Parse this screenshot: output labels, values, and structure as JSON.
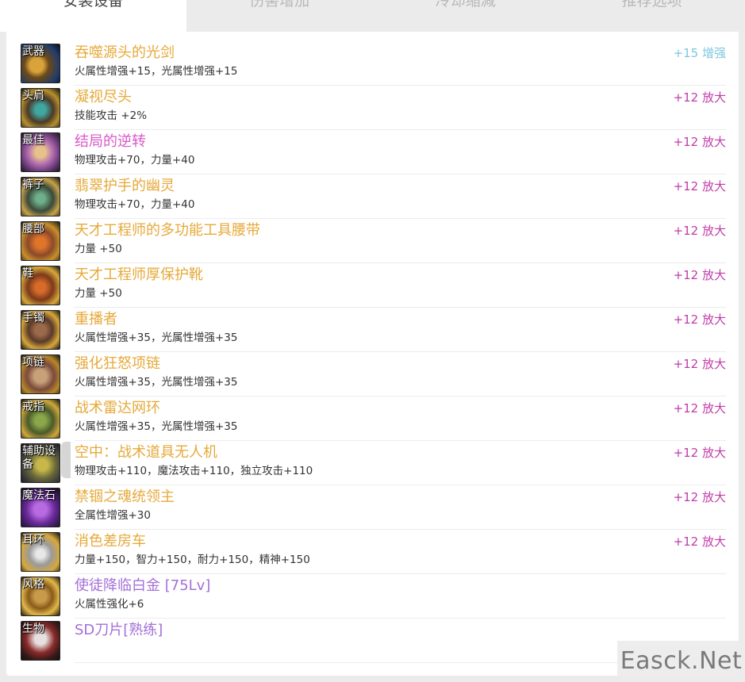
{
  "tabs": [
    {
      "label": "安装设备",
      "active": true
    },
    {
      "label": "伤害增加",
      "active": false
    },
    {
      "label": "冷却缩减",
      "active": false
    },
    {
      "label": "推荐选项",
      "active": false
    }
  ],
  "colors": {
    "name_gold": "#e6a93a",
    "name_pink": "#d858c8",
    "name_purple": "#a470d8",
    "amp_pink": "#c23aa8",
    "enhance_cyan": "#7cc7e0"
  },
  "items": [
    {
      "slot": "武器",
      "icon": "weapon-sword-icon",
      "name": "吞噬源头的光剑",
      "name_color": "#e6a93a",
      "stats": "火属性增强+15，光属性增强+15",
      "amp": "+15 增强",
      "amp_color": "#7cc7e0"
    },
    {
      "slot": "头肩",
      "icon": "shoulder-armor-icon",
      "name": "凝视尽头",
      "name_color": "#e6a93a",
      "stats": "技能攻击 +2%",
      "amp": "+12 放大",
      "amp_color": "#c23aa8"
    },
    {
      "slot": "最佳",
      "icon": "top-armor-icon",
      "name": "结局的逆转",
      "name_color": "#d858c8",
      "stats": "物理攻击+70，力量+40",
      "amp": "+12 放大",
      "amp_color": "#c23aa8"
    },
    {
      "slot": "裤子",
      "icon": "pants-armor-icon",
      "name": "翡翠护手的幽灵",
      "name_color": "#e6a93a",
      "stats": "物理攻击+70，力量+40",
      "amp": "+12 放大",
      "amp_color": "#c23aa8"
    },
    {
      "slot": "腰部",
      "icon": "belt-icon",
      "name": "天才工程师的多功能工具腰带",
      "name_color": "#e6a93a",
      "stats": "力量 +50",
      "amp": "+12 放大",
      "amp_color": "#c23aa8"
    },
    {
      "slot": "鞋",
      "icon": "boots-icon",
      "name": "天才工程师厚保护靴",
      "name_color": "#e6a93a",
      "stats": "力量 +50",
      "amp": "+12 放大",
      "amp_color": "#c23aa8"
    },
    {
      "slot": "手镯",
      "icon": "bracelet-icon",
      "name": "重播者",
      "name_color": "#e6a93a",
      "stats": "火属性增强+35，光属性增强+35",
      "amp": "+12 放大",
      "amp_color": "#c23aa8"
    },
    {
      "slot": "项链",
      "icon": "necklace-icon",
      "name": "强化狂怒项链",
      "name_color": "#e6a93a",
      "stats": "火属性增强+35，光属性增强+35",
      "amp": "+12 放大",
      "amp_color": "#c23aa8"
    },
    {
      "slot": "戒指",
      "icon": "ring-icon",
      "name": "战术雷达网环",
      "name_color": "#e6a93a",
      "stats": "火属性增强+35，光属性增强+35",
      "amp": "+12 放大",
      "amp_color": "#c23aa8"
    },
    {
      "slot": "辅助设备",
      "icon": "support-equipment-icon",
      "name": "空中：战术道具无人机",
      "name_color": "#e6a93a",
      "stats": "物理攻击+110，魔法攻击+110，独立攻击+110",
      "amp": "+12 放大",
      "amp_color": "#c23aa8"
    },
    {
      "slot": "魔法石",
      "icon": "magic-stone-icon",
      "name": "禁锢之魂统领主",
      "name_color": "#e6a93a",
      "stats": "全属性增强+30",
      "amp": "+12 放大",
      "amp_color": "#c23aa8"
    },
    {
      "slot": "耳环",
      "icon": "earring-icon",
      "name": "消色差房车",
      "name_color": "#e6a93a",
      "stats": "力量+150，智力+150，耐力+150，精神+150",
      "amp": "+12 放大",
      "amp_color": "#c23aa8"
    },
    {
      "slot": "风格",
      "icon": "title-style-icon",
      "name": "使徒降临白金 [75Lv]",
      "name_color": "#a470d8",
      "stats": "火属性强化+6",
      "amp": "",
      "amp_color": "#c23aa8"
    },
    {
      "slot": "生物",
      "icon": "creature-pet-icon",
      "name": "SD刀片[熟练]",
      "name_color": "#a470d8",
      "stats": "",
      "amp": "",
      "amp_color": "#c23aa8"
    }
  ],
  "watermark": "Easck.Net"
}
